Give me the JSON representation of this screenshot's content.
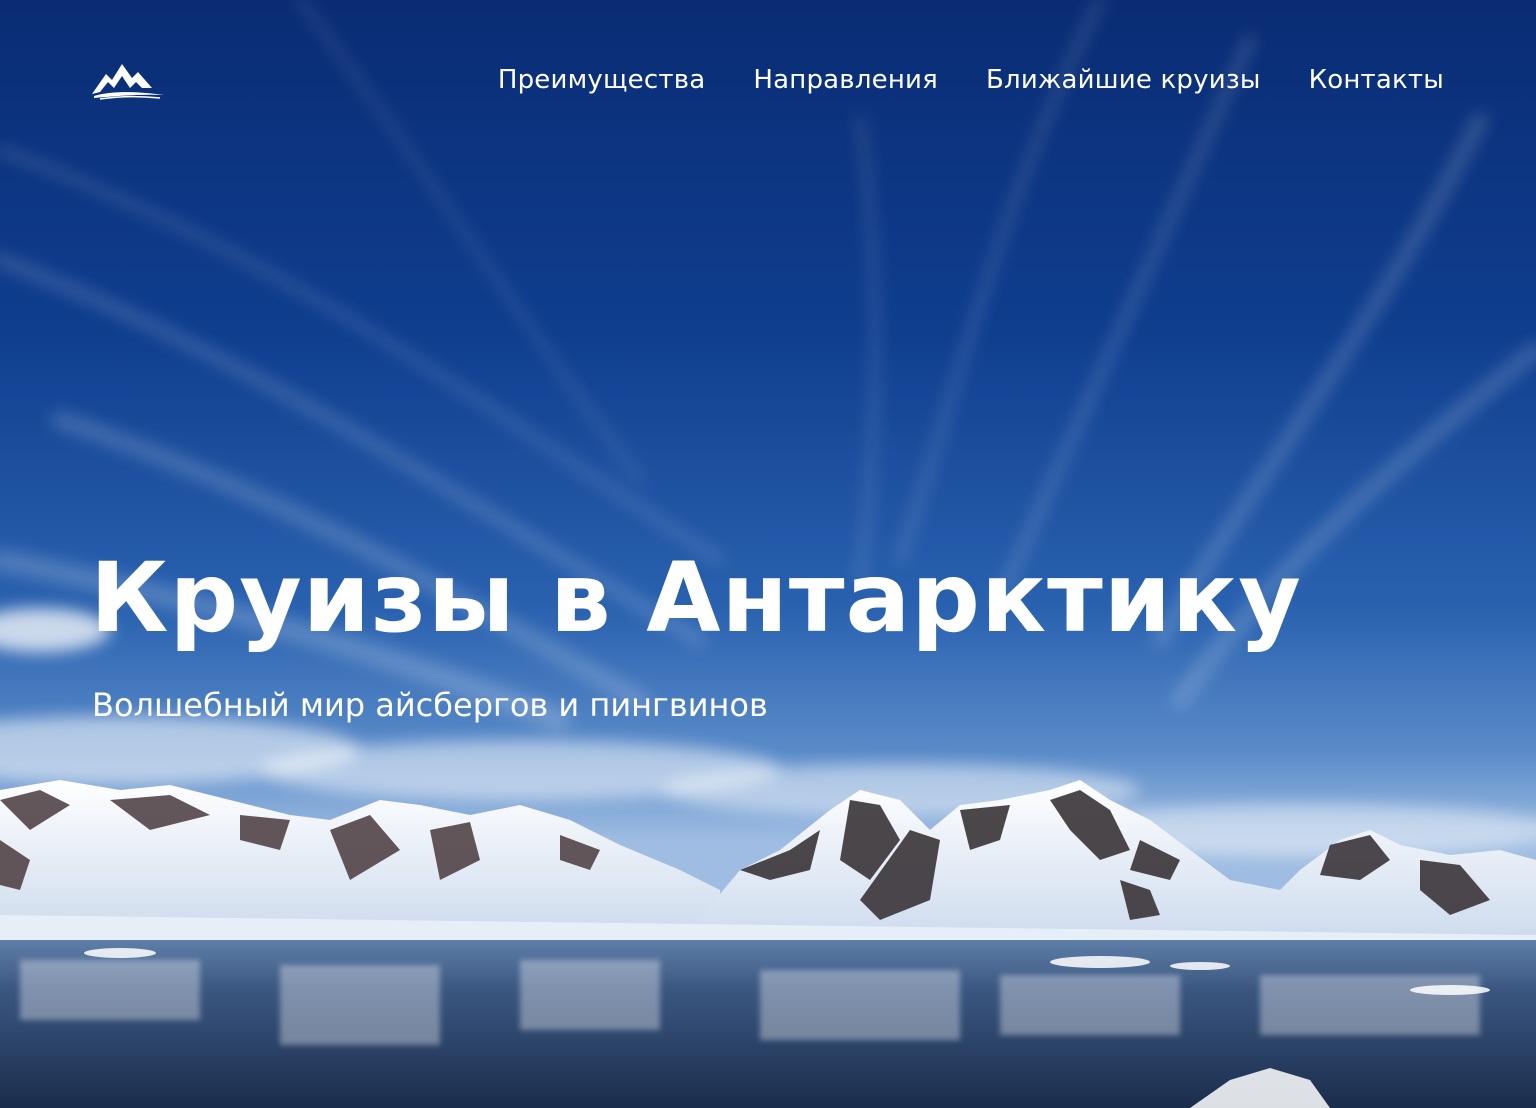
{
  "header": {
    "logo_icon": "mountain-logo-icon",
    "nav": [
      {
        "label": "Преимущества"
      },
      {
        "label": "Направления"
      },
      {
        "label": "Ближайшие круизы"
      },
      {
        "label": "Контакты"
      }
    ]
  },
  "hero": {
    "title": "Круизы в Антарктику",
    "subtitle": "Волшебный мир айсбергов и пингвинов",
    "background": "antarctic-mountains-photo"
  },
  "colors": {
    "sky_top": "#0b2f7a",
    "sky_mid": "#1e55a6",
    "snow": "#f3f6fb",
    "rock": "#3a3438",
    "water": "#223a5c",
    "text": "#ffffff"
  }
}
